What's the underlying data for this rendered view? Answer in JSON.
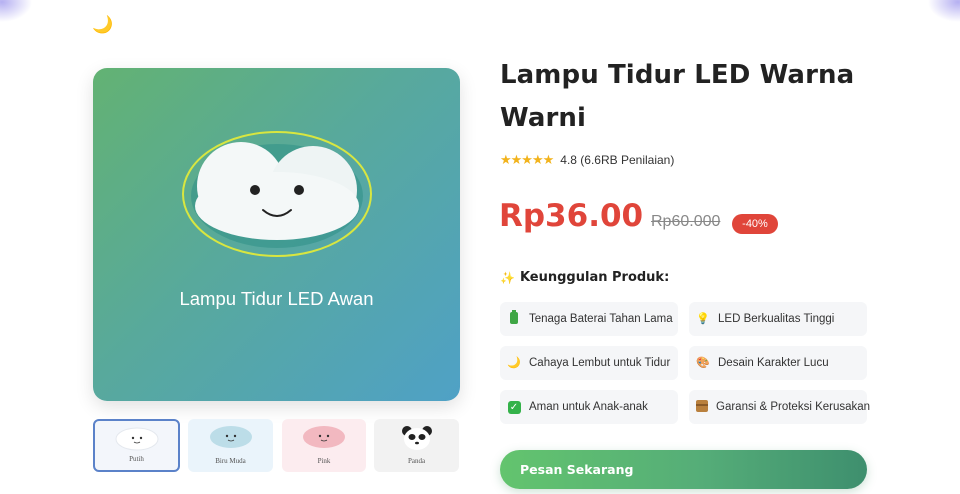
{
  "header": {
    "theme_icon": "moon-icon"
  },
  "gallery": {
    "main_caption": "Lampu Tidur LED Awan",
    "thumbnails": [
      {
        "label": "Putih",
        "color": "#ffffff",
        "selected": true
      },
      {
        "label": "Biru Muda",
        "color": "#bcdde8",
        "selected": false
      },
      {
        "label": "Pink",
        "color": "#f2b8c0",
        "selected": false
      },
      {
        "label": "Panda",
        "color": "#ffffff",
        "selected": false
      }
    ]
  },
  "product": {
    "title": "Lampu Tidur LED Warna Warni",
    "rating_value": 4.8,
    "stars": "★★★★★",
    "rating_text": "4.8 (6.6RB Penilaian)",
    "price": "Rp36.00",
    "price_old": "Rp60.000",
    "discount": "-40%"
  },
  "features": {
    "heading_icon": "✨",
    "heading": "Keunggulan Produk:",
    "items": [
      {
        "icon": "battery-icon",
        "label": "Tenaga Baterai Tahan Lama"
      },
      {
        "icon": "bulb-icon",
        "glyph": "💡",
        "label": "LED Berkualitas Tinggi"
      },
      {
        "icon": "moon-icon",
        "glyph": "🌙",
        "label": "Cahaya Lembut untuk Tidur"
      },
      {
        "icon": "palette-icon",
        "glyph": "🎨",
        "label": "Desain Karakter Lucu"
      },
      {
        "icon": "check-icon",
        "glyph": "✓",
        "label": "Aman untuk Anak-anak"
      },
      {
        "icon": "box-icon",
        "label": "Garansi & Proteksi Kerusakan"
      }
    ]
  },
  "cta": {
    "label": "Pesan Sekarang"
  },
  "colors": {
    "accent_green": "#55ad78",
    "price_red": "#e0453a",
    "star_gold": "#f2b31c"
  }
}
